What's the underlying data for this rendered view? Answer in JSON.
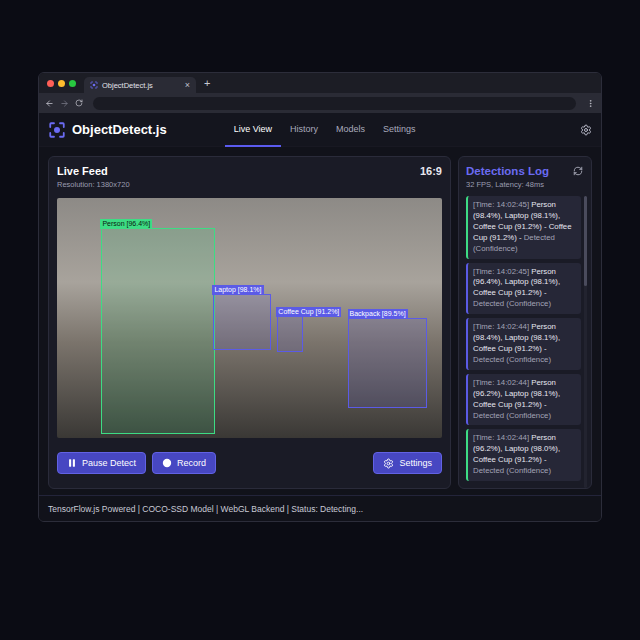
{
  "browser": {
    "tab_title": "ObjectDetect.js",
    "tab_close": "×",
    "new_tab": "+"
  },
  "app": {
    "title": "ObjectDetect.js"
  },
  "nav": [
    {
      "label": "Live View",
      "selected": true
    },
    {
      "label": "History",
      "selected": false
    },
    {
      "label": "Models",
      "selected": false
    },
    {
      "label": "Settings",
      "selected": false
    }
  ],
  "live_feed": {
    "title": "Live Feed",
    "resolution": "Resolution: 1380x720",
    "aspect": "16:9",
    "detections": [
      {
        "label": "Person [96.4%]",
        "color": "#3ddc84"
      },
      {
        "label": "Laptop [98.1%]",
        "color": "#5b5be6"
      },
      {
        "label": "Coffee Cup [91.2%]",
        "color": "#5b5be6"
      },
      {
        "label": "Backpack [89.5%]",
        "color": "#5b5be6"
      }
    ]
  },
  "controls": [
    {
      "label": "Pause Detect",
      "kind": "pause"
    },
    {
      "label": "Record",
      "kind": "record"
    },
    {
      "label": "Settings",
      "kind": "settings"
    }
  ],
  "log": {
    "title": "Detections Log",
    "stats": "32 FPS, Latency: 48ms",
    "entries": [
      {
        "time": "[Time: 14:02:45]",
        "text": "Person (98.4%), Laptop (98.1%), Coffee Cup (91.2%) - Coffee Cup (91.2%) -",
        "status": "Detected (Confidence)",
        "color": "#3ddc84"
      },
      {
        "time": "[Time: 14:02:45]",
        "text": "Person (96.4%), Laptop (98.1%), Coffee Cup (91.2%) -",
        "status": "Detected (Confidence)",
        "color": "#5b5be6"
      },
      {
        "time": "[Time: 14:02:44]",
        "text": "Person (98.4%), Laptop (98.1%), Coffee Cup (91.2%) -",
        "status": "Detected (Confidence)",
        "color": "#5b5be6"
      },
      {
        "time": "[Time: 14:02:44]",
        "text": "Person (96.2%), Laptop (98.1%), Coffee Cup (91.2%) -",
        "status": "Detected (Confidence)",
        "color": "#5b5be6"
      },
      {
        "time": "[Time: 14:02:44]",
        "text": "Person (96.2%), Laptop (98.0%), Coffee Cup (91.2%) -",
        "status": "Detected (Confidence)",
        "color": "#3ddc84"
      }
    ]
  },
  "status_bar": "TensorFlow.js Powered | COCO-SSD Model | WebGL Backend | Status: Detecting..."
}
